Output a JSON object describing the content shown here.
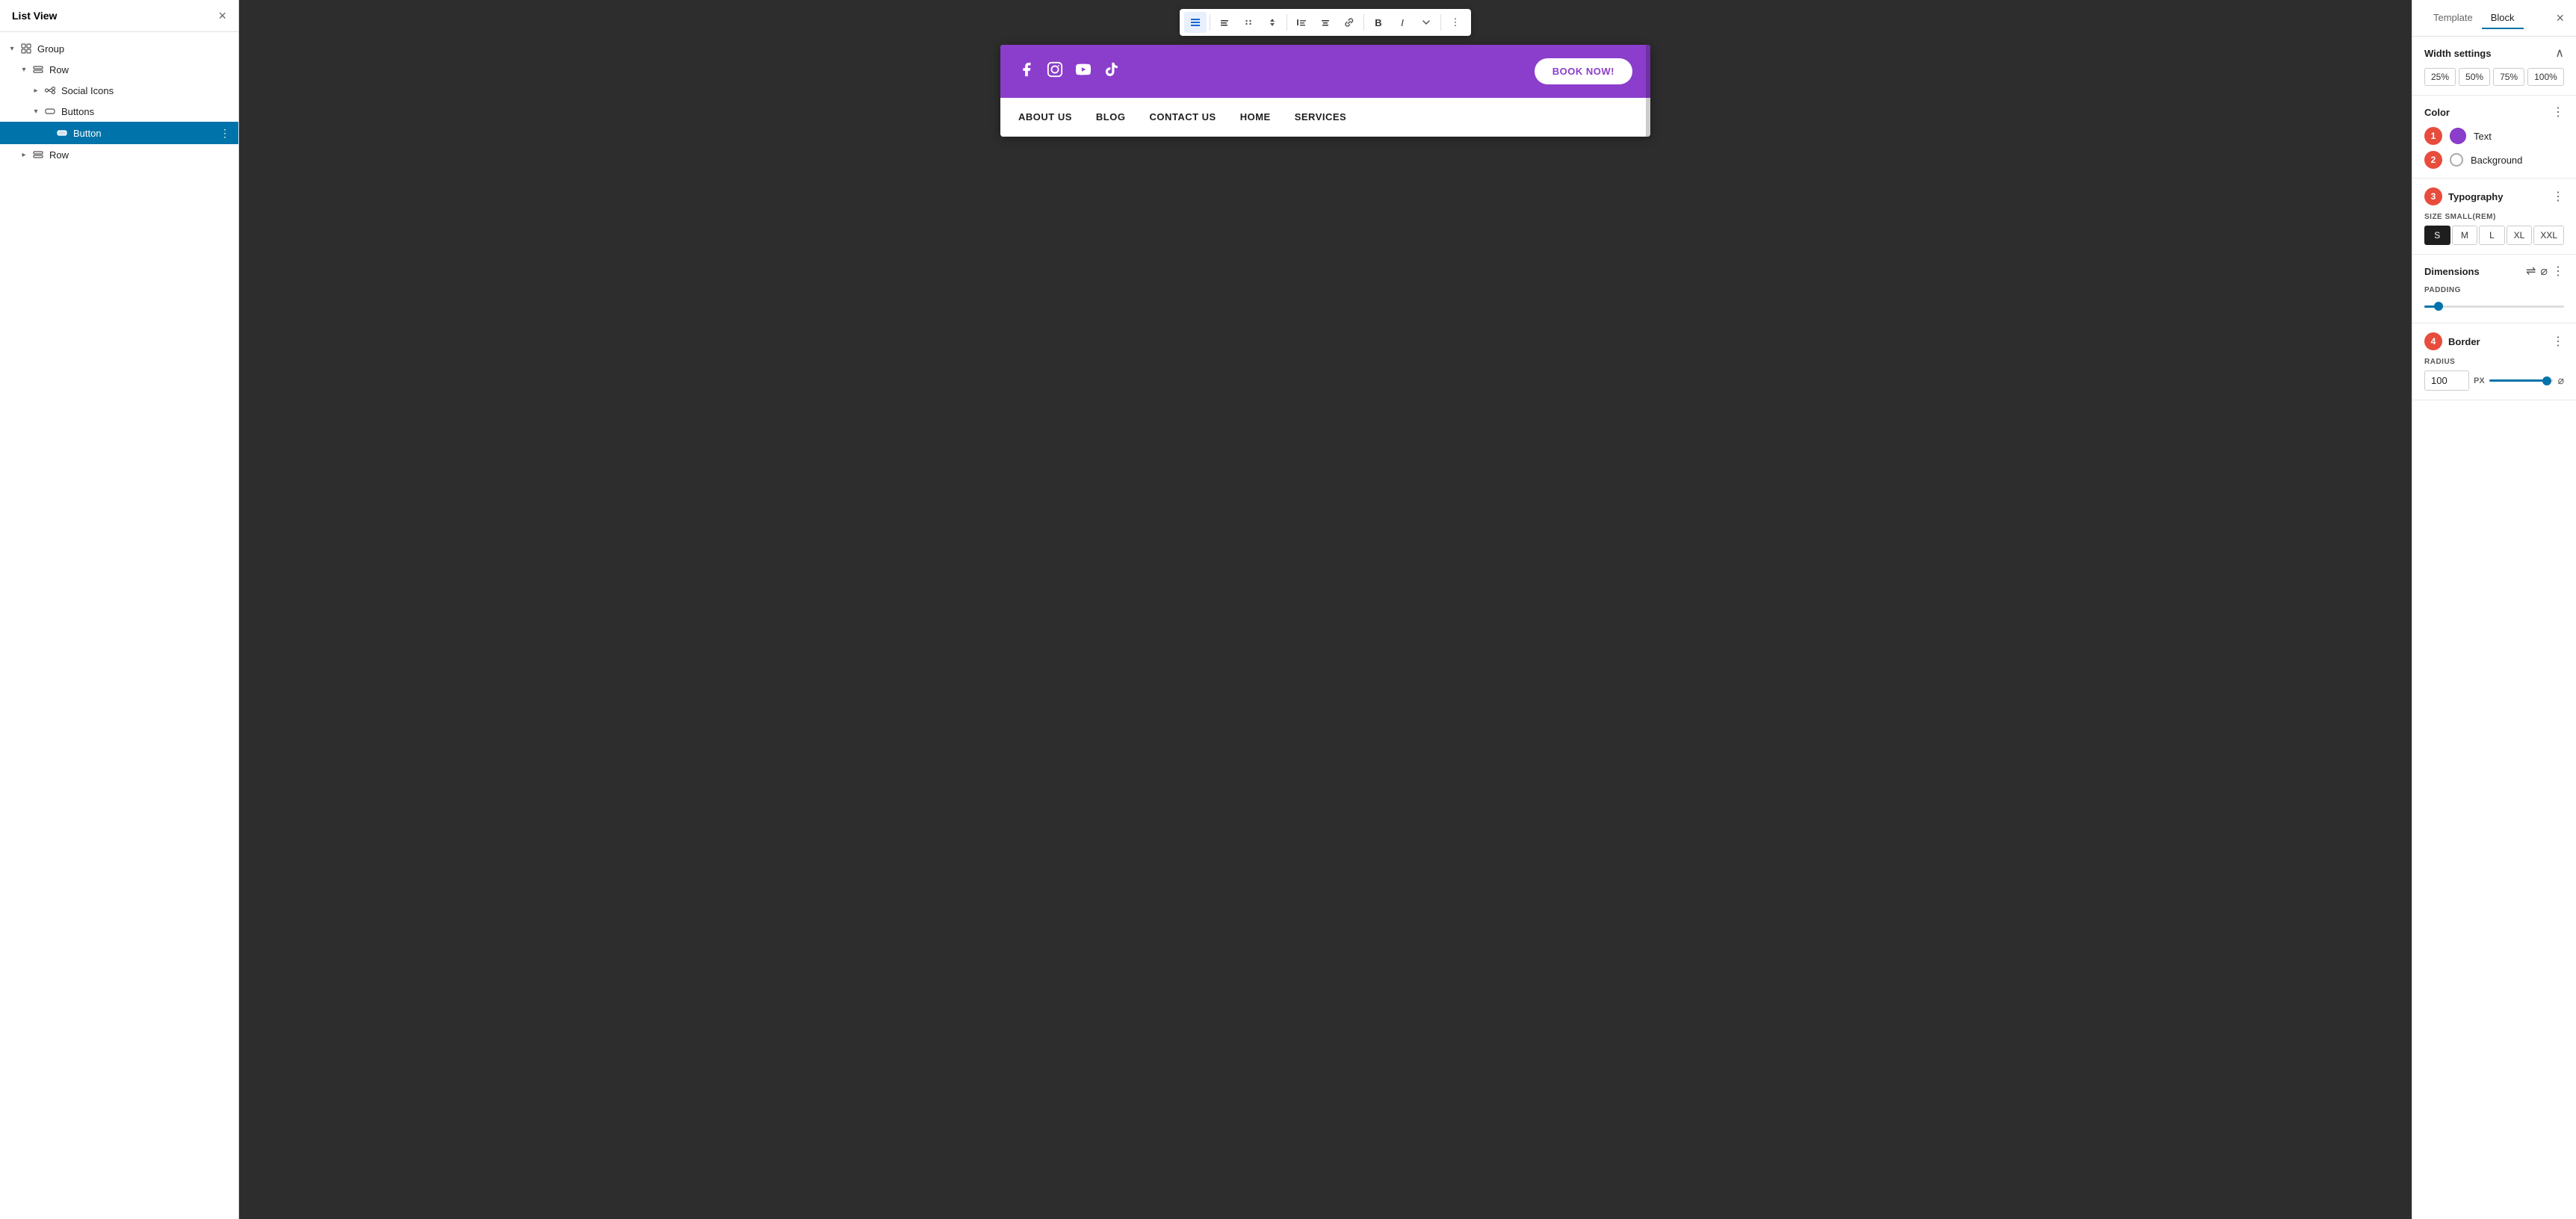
{
  "leftPanel": {
    "title": "List View",
    "closeButton": "×",
    "treeItems": [
      {
        "id": "group",
        "label": "Group",
        "icon": "group",
        "indent": 0,
        "expanded": true,
        "chevron": "down"
      },
      {
        "id": "row1",
        "label": "Row",
        "icon": "row",
        "indent": 1,
        "expanded": true,
        "chevron": "down"
      },
      {
        "id": "social-icons",
        "label": "Social Icons",
        "icon": "social",
        "indent": 2,
        "expanded": false,
        "chevron": "right"
      },
      {
        "id": "buttons",
        "label": "Buttons",
        "icon": "buttons",
        "indent": 2,
        "expanded": true,
        "chevron": "down"
      },
      {
        "id": "button",
        "label": "Button",
        "icon": "button",
        "indent": 3,
        "expanded": false,
        "chevron": "empty",
        "selected": true
      },
      {
        "id": "row2",
        "label": "Row",
        "icon": "row",
        "indent": 1,
        "expanded": false,
        "chevron": "right"
      }
    ]
  },
  "canvas": {
    "preview": {
      "socialIcons": [
        "f",
        "instagram",
        "youtube",
        "tiktok"
      ],
      "bookButton": "BOOK NOW!",
      "navItems": [
        "ABOUT US",
        "BLOG",
        "CONTACT US",
        "HOME",
        "SERVICES"
      ]
    }
  },
  "rightPanel": {
    "tabs": [
      "Template",
      "Block"
    ],
    "activeTab": "Block",
    "closeButton": "×",
    "widthSettings": {
      "title": "Width settings",
      "options": [
        "25%",
        "50%",
        "75%",
        "100%"
      ]
    },
    "color": {
      "title": "Color",
      "items": [
        {
          "id": "text",
          "label": "Text",
          "type": "swatch",
          "color": "#8b3dcc"
        },
        {
          "id": "background",
          "label": "Background",
          "type": "radio"
        }
      ]
    },
    "typography": {
      "title": "Typography",
      "sizeLabel": "SIZE SMALL(REM)",
      "sizes": [
        "S",
        "M",
        "L",
        "XL",
        "XXL"
      ],
      "activeSize": "S"
    },
    "dimensions": {
      "title": "Dimensions",
      "paddingLabel": "PADDING",
      "sliderValue": 10
    },
    "border": {
      "title": "Border",
      "radiusLabel": "RADIUS",
      "radiusValue": "100",
      "radiusUnit": "PX",
      "sliderValue": 90
    }
  },
  "badges": {
    "1": "1",
    "2": "2",
    "3": "3",
    "4": "4"
  }
}
